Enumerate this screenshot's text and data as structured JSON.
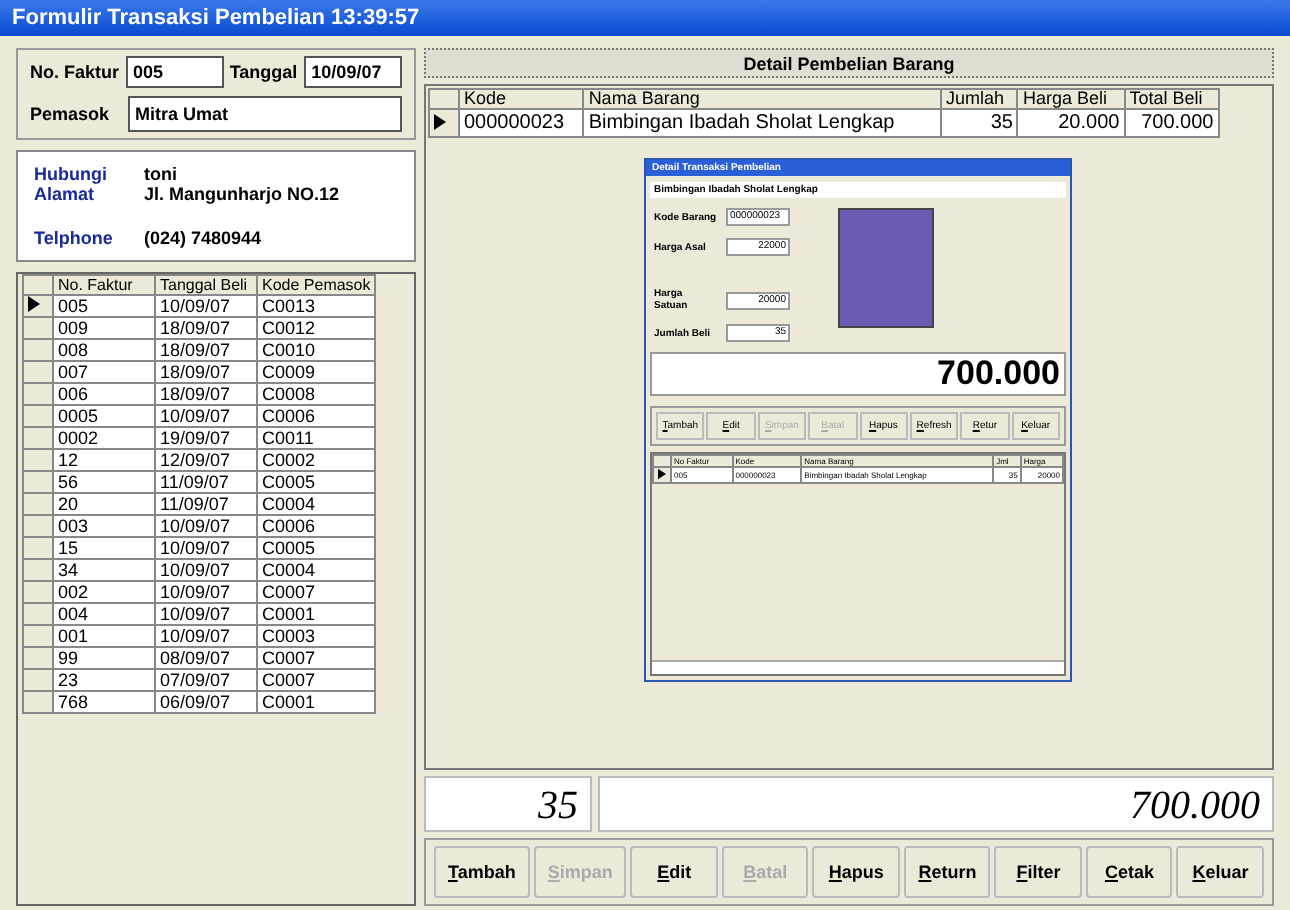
{
  "window": {
    "title": "Formulir Transaksi Pembelian 13:39:57"
  },
  "header": {
    "faktur_label": "No. Faktur",
    "faktur": "005",
    "tanggal_label": "Tanggal",
    "tanggal": "10/09/07",
    "pemasok_label": "Pemasok",
    "pemasok": "Mitra Umat"
  },
  "contact": [
    {
      "label": "Hubungi",
      "value": "toni"
    },
    {
      "label": "Alamat",
      "value": "Jl. Mangunharjo NO.12"
    },
    {
      "label": "Telphone",
      "value": "(024) 7480944"
    }
  ],
  "faktur_table": {
    "columns": [
      "No. Faktur",
      "Tanggal Beli",
      "Kode Pemasok"
    ],
    "rows": [
      {
        "cells": [
          "005",
          "10/09/07",
          "C0013"
        ],
        "selected": true
      },
      {
        "cells": [
          "009",
          "18/09/07",
          "C0012"
        ],
        "selected": false
      },
      {
        "cells": [
          "008",
          "18/09/07",
          "C0010"
        ],
        "selected": false
      },
      {
        "cells": [
          "007",
          "18/09/07",
          "C0009"
        ],
        "selected": false
      },
      {
        "cells": [
          "006",
          "18/09/07",
          "C0008"
        ],
        "selected": false
      },
      {
        "cells": [
          "0005",
          "10/09/07",
          "C0006"
        ],
        "selected": false
      },
      {
        "cells": [
          "0002",
          "19/09/07",
          "C0011"
        ],
        "selected": false
      },
      {
        "cells": [
          "12",
          "12/09/07",
          "C0002"
        ],
        "selected": false
      },
      {
        "cells": [
          "56",
          "11/09/07",
          "C0005"
        ],
        "selected": false
      },
      {
        "cells": [
          "20",
          "11/09/07",
          "C0004"
        ],
        "selected": false
      },
      {
        "cells": [
          "003",
          "10/09/07",
          "C0006"
        ],
        "selected": false
      },
      {
        "cells": [
          "15",
          "10/09/07",
          "C0005"
        ],
        "selected": false
      },
      {
        "cells": [
          "34",
          "10/09/07",
          "C0004"
        ],
        "selected": false
      },
      {
        "cells": [
          "002",
          "10/09/07",
          "C0007"
        ],
        "selected": false
      },
      {
        "cells": [
          "004",
          "10/09/07",
          "C0001"
        ],
        "selected": false
      },
      {
        "cells": [
          "001",
          "10/09/07",
          "C0003"
        ],
        "selected": false
      },
      {
        "cells": [
          "99",
          "08/09/07",
          "C0007"
        ],
        "selected": false
      },
      {
        "cells": [
          "23",
          "07/09/07",
          "C0007"
        ],
        "selected": false
      },
      {
        "cells": [
          "768",
          "06/09/07",
          "C0001"
        ],
        "selected": false
      }
    ]
  },
  "detail": {
    "title": "Detail Pembelian Barang",
    "columns": [
      "Kode",
      "Nama Barang",
      "Jumlah",
      "Harga Beli",
      "Total Beli"
    ],
    "rows": [
      {
        "cells": [
          "000000023",
          "Bimbingan Ibadah Sholat Lengkap",
          "35",
          "20.000",
          "700.000"
        ],
        "selected": true
      }
    ]
  },
  "inner_window": {
    "title": "Detail Transaksi Pembelian",
    "product": "Bimbingan Ibadah Sholat Lengkap",
    "fields": [
      {
        "label": "Kode Barang",
        "value": "000000023"
      },
      {
        "label": "Harga Asal",
        "value": "22000"
      },
      {
        "label": "Harga Satuan",
        "value": "20000"
      },
      {
        "label": "Jumlah Beli",
        "value": "35"
      }
    ],
    "total": "700.000",
    "buttons": [
      {
        "label": "Tambah",
        "disabled": false
      },
      {
        "label": "Edit",
        "disabled": false
      },
      {
        "label": "Simpan",
        "disabled": true
      },
      {
        "label": "Batal",
        "disabled": true
      },
      {
        "label": "Hapus",
        "disabled": false
      },
      {
        "label": "Refresh",
        "disabled": false
      },
      {
        "label": "Retur",
        "disabled": false
      },
      {
        "label": "Keluar",
        "disabled": false
      }
    ],
    "table": {
      "columns": [
        "No Faktur",
        "Kode",
        "Nama Barang",
        "Jml",
        "Harga"
      ],
      "rows": [
        {
          "cells": [
            "005",
            "000000023",
            "Bimbingan Ibadah Sholat Lengkap",
            "35",
            "20000"
          ],
          "selected": true
        }
      ]
    }
  },
  "totals": {
    "quantity": "35",
    "amount": "700.000"
  },
  "buttons": [
    {
      "label": "Tambah",
      "disabled": false
    },
    {
      "label": "Simpan",
      "disabled": true
    },
    {
      "label": "Edit",
      "disabled": false
    },
    {
      "label": "Batal",
      "disabled": true
    },
    {
      "label": "Hapus",
      "disabled": false
    },
    {
      "label": "Return",
      "disabled": false
    },
    {
      "label": "Filter",
      "disabled": false
    },
    {
      "label": "Cetak",
      "disabled": false
    },
    {
      "label": "Keluar",
      "disabled": false
    }
  ]
}
